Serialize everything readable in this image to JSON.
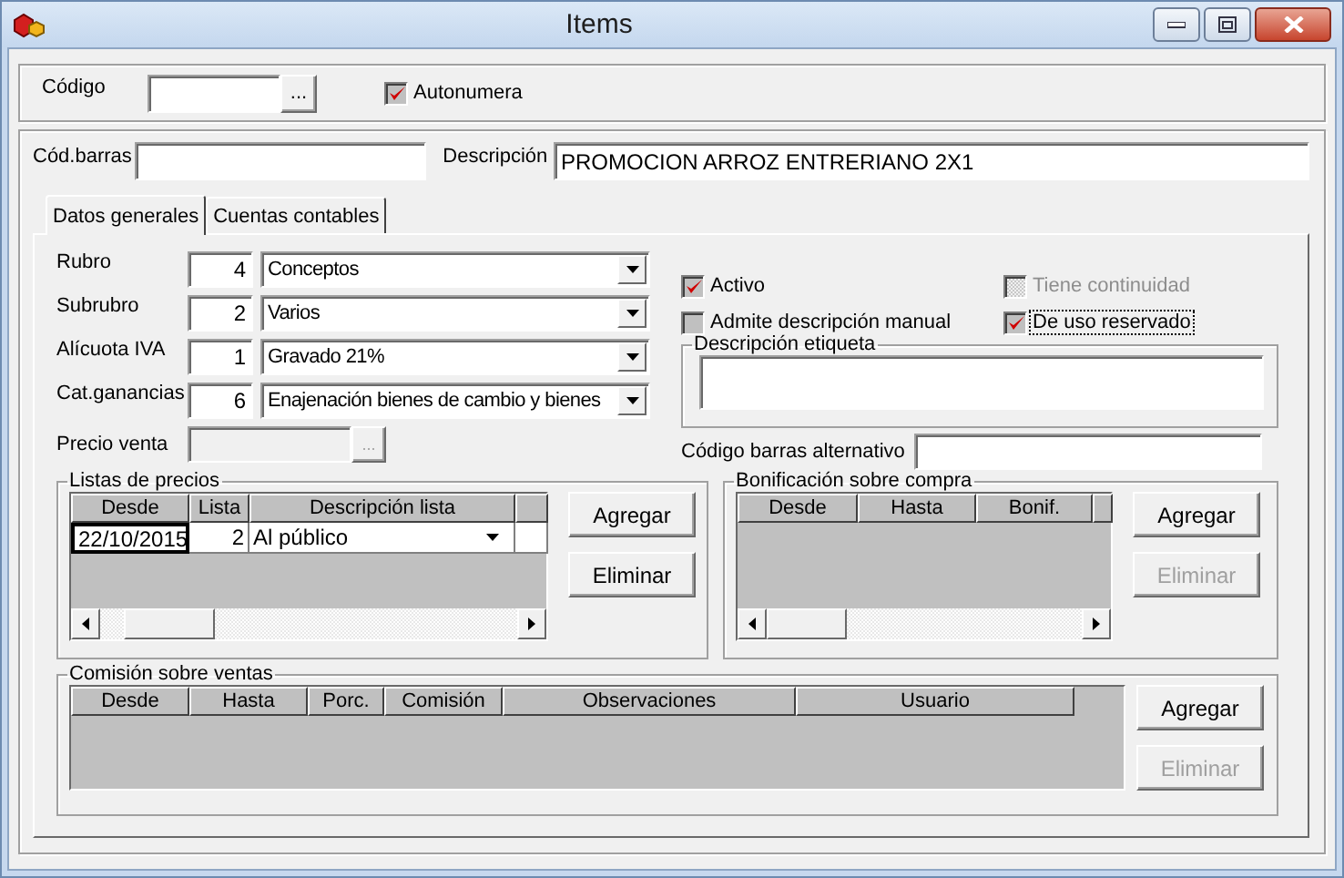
{
  "window": {
    "title": "Items"
  },
  "header": {
    "codigo": {
      "label": "Código",
      "button": "..."
    },
    "autonumera": {
      "label": "Autonumera",
      "checked": true
    }
  },
  "barcode": {
    "label": "Cód.barras"
  },
  "description": {
    "label": "Descripción",
    "value": "PROMOCION ARROZ ENTRERIANO 2X1"
  },
  "tabs": [
    {
      "label": "Datos generales",
      "selected": true
    },
    {
      "label": "Cuentas contables",
      "selected": false
    }
  ],
  "lookups": [
    {
      "label": "Rubro",
      "code": "4",
      "value": "Conceptos"
    },
    {
      "label": "Subrubro",
      "code": "2",
      "value": "Varios"
    },
    {
      "label": "Alícuota IVA",
      "code": "1",
      "value": "Gravado 21%"
    },
    {
      "label": "Cat.ganancias",
      "code": "6",
      "value": "Enajenación bienes de cambio y bienes"
    }
  ],
  "precio_venta": {
    "label": "Precio venta",
    "button": "...",
    "disabled": true
  },
  "checkboxes": [
    {
      "label": "Activo",
      "checked": true,
      "disabled": false,
      "focused": false
    },
    {
      "label": "Tiene continuidad",
      "checked": false,
      "disabled": true,
      "focused": false
    },
    {
      "label": "Admite descripción manual",
      "checked": false,
      "disabled": false,
      "focused": false
    },
    {
      "label": "De uso reservado",
      "checked": true,
      "disabled": false,
      "focused": true
    }
  ],
  "descripcion_etiqueta": {
    "label": "Descripción etiqueta"
  },
  "codigo_alternativo": {
    "label": "Código barras alternativo"
  },
  "listas_precios": {
    "title": "Listas de precios",
    "columns": [
      "Desde",
      "Lista",
      "Descripción lista"
    ],
    "rows": [
      {
        "desde": "22/10/2015",
        "lista": "2",
        "descripcion": "Al público"
      }
    ],
    "buttons": [
      {
        "label": "Agregar",
        "disabled": false
      },
      {
        "label": "Eliminar",
        "disabled": false
      }
    ]
  },
  "bonificacion": {
    "title": "Bonificación sobre compra",
    "columns": [
      "Desde",
      "Hasta",
      "Bonif."
    ],
    "buttons": [
      {
        "label": "Agregar",
        "disabled": false
      },
      {
        "label": "Eliminar",
        "disabled": true
      }
    ]
  },
  "comision": {
    "title": "Comisión sobre ventas",
    "columns": [
      "Desde",
      "Hasta",
      "Porc.",
      "Comisión",
      "Observaciones",
      "Usuario"
    ],
    "buttons": [
      {
        "label": "Agregar",
        "disabled": false
      },
      {
        "label": "Eliminar",
        "disabled": true
      }
    ]
  }
}
